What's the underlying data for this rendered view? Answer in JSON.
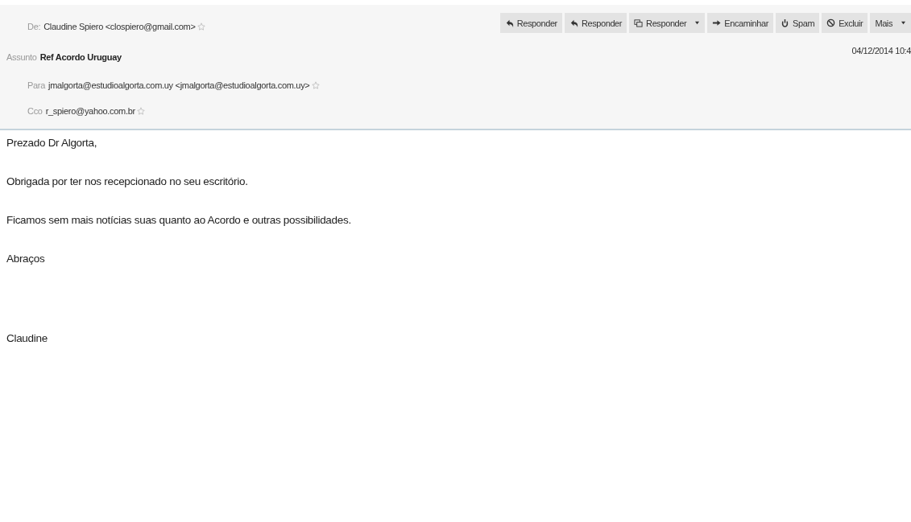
{
  "header": {
    "from": {
      "label": "De:",
      "value": "Claudine Spiero <clospiero@gmail.com>"
    },
    "subject": {
      "label": "Assunto",
      "value": "Ref Acordo Uruguay"
    },
    "to": {
      "label": "Para",
      "value": "jmalgorta@estudioalgorta.com.uy <jmalgorta@estudioalgorta.com.uy>"
    },
    "bcc": {
      "label": "Cco",
      "value": "r_spiero@yahoo.com.br"
    },
    "date": "04/12/2014 10:4"
  },
  "toolbar": [
    {
      "kind": "reply",
      "label": "Responder",
      "dropdown": false
    },
    {
      "kind": "reply",
      "label": "Responder",
      "dropdown": false
    },
    {
      "kind": "reply-all",
      "label": "Responder",
      "dropdown": true
    },
    {
      "kind": "forward",
      "label": "Encaminhar",
      "dropdown": false
    },
    {
      "kind": "spam",
      "label": "Spam",
      "dropdown": false
    },
    {
      "kind": "delete",
      "label": "Excluir",
      "dropdown": false
    },
    {
      "kind": "more",
      "label": "Mais",
      "dropdown": true
    }
  ],
  "body": [
    "Prezado Dr Algorta,",
    "Obrigada por ter nos recepcionado no seu escritório.",
    "Ficamos sem mais notícias suas quanto ao Acordo e outras possibilidades.",
    "Abraços"
  ],
  "signature": "Claudine"
}
